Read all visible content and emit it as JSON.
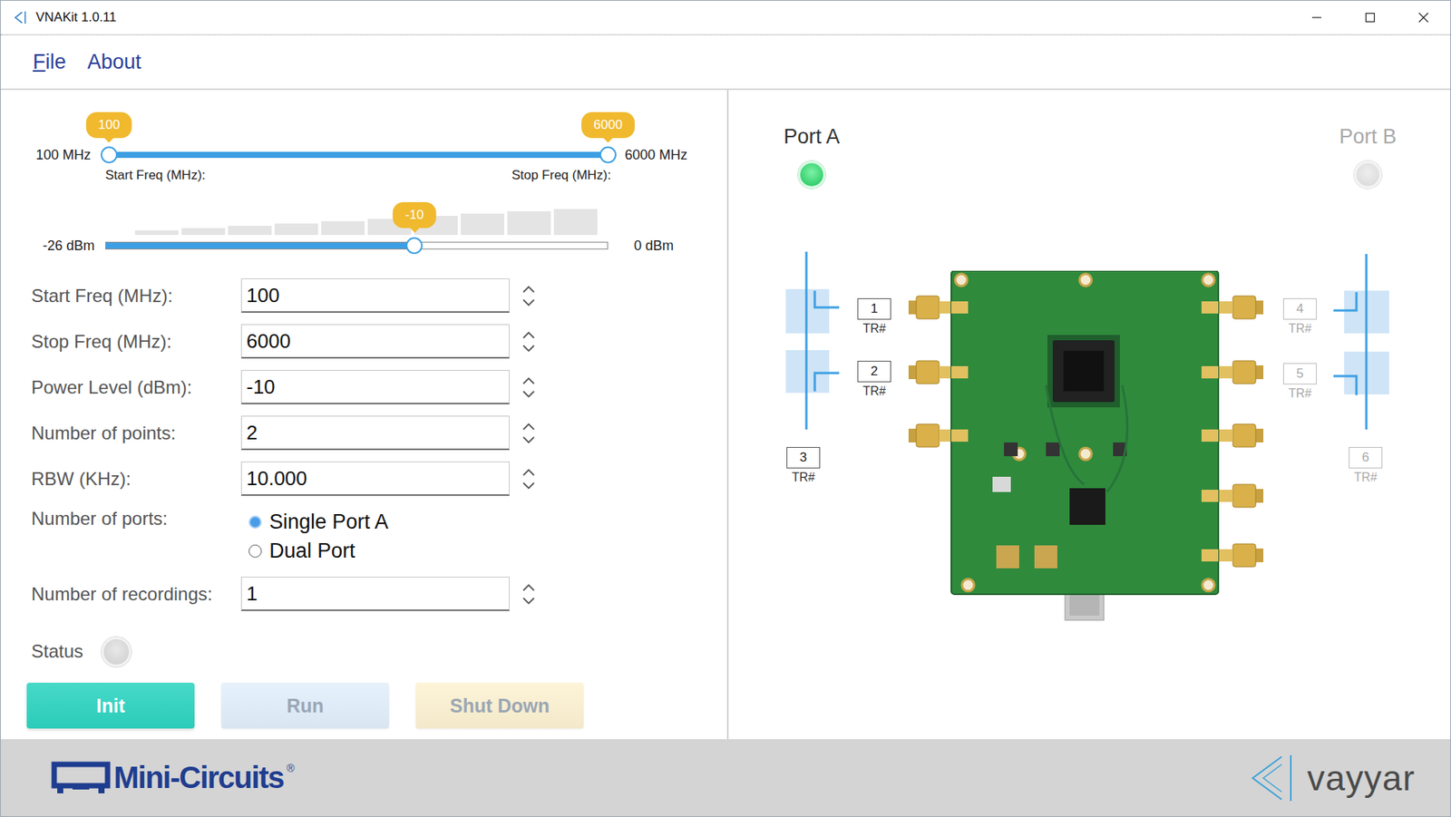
{
  "window": {
    "title": "VNAKit 1.0.11"
  },
  "menu": [
    {
      "label": "File",
      "mnemonic": true
    },
    {
      "label": "About",
      "mnemonic": false
    }
  ],
  "frequency_slider": {
    "min_label": "100 MHz",
    "max_label": "6000 MHz",
    "start_value": "100",
    "stop_value": "6000",
    "start_caption": "Start Freq (MHz):",
    "stop_caption": "Stop Freq (MHz):",
    "start_level": 0,
    "stop_level": 1
  },
  "power_slider": {
    "min_label": "-26 dBm",
    "max_label": "0 dBm",
    "value": "-10",
    "level": 0.615
  },
  "settings": [
    {
      "kind": "spin",
      "label": "Start Freq (MHz):",
      "value": "100"
    },
    {
      "kind": "spin",
      "label": "Stop Freq (MHz):",
      "value": "6000"
    },
    {
      "kind": "spin",
      "label": "Power Level (dBm):",
      "value": "-10"
    },
    {
      "kind": "spin",
      "label": "Number of points:",
      "value": "2"
    },
    {
      "kind": "spin",
      "label": "RBW (KHz):",
      "value": "10.000"
    },
    {
      "kind": "radio",
      "label": "Number of ports:",
      "options": [
        {
          "label": "Single Port A",
          "selected": true
        },
        {
          "label": "Dual Port",
          "selected": false
        }
      ]
    },
    {
      "kind": "spin",
      "label": "Number of recordings:",
      "value": "1"
    }
  ],
  "status": {
    "label": "Status",
    "on": false
  },
  "buttons": [
    {
      "label": "Init",
      "disabled": false,
      "color": "#2dd4c1"
    },
    {
      "label": "Run",
      "disabled": true,
      "color": "#e2effb"
    },
    {
      "label": "Shut Down",
      "disabled": true,
      "color": "#fdf2d2"
    }
  ],
  "ports": [
    {
      "label": "Port A",
      "active": true
    },
    {
      "label": "Port B",
      "active": false
    }
  ],
  "transceivers": [
    {
      "number": "1",
      "label": "TR#",
      "active": true
    },
    {
      "number": "2",
      "label": "TR#",
      "active": true
    },
    {
      "number": "3",
      "label": "TR#",
      "active": true
    },
    {
      "number": "4",
      "label": "TR#",
      "active": false
    },
    {
      "number": "5",
      "label": "TR#",
      "active": false
    },
    {
      "number": "6",
      "label": "TR#",
      "active": false
    }
  ],
  "footer": {
    "left_logo": "Mini-Circuits",
    "left_logo_mark": "®",
    "right_logo": "vayyar"
  }
}
